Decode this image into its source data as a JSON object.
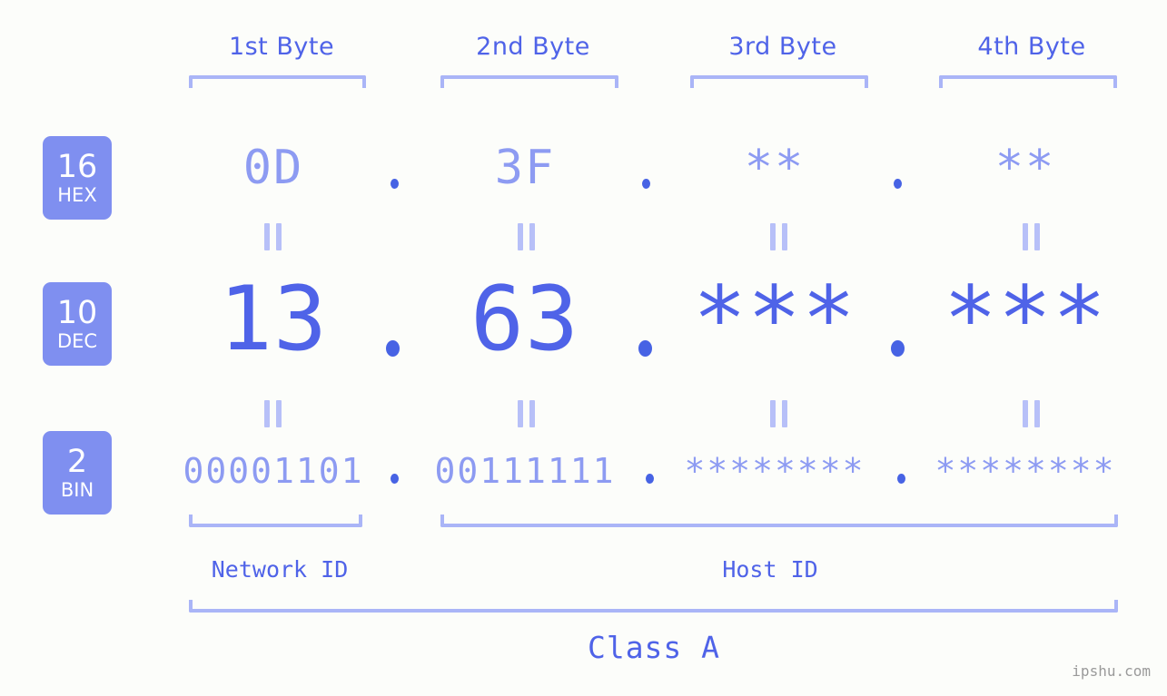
{
  "page": {
    "background_color": "#fcfdfa",
    "accent_color": "#4f63e8",
    "accent_light_color": "#8d9bf2",
    "bracket_color": "#aab5f7",
    "badge_color": "#7f8ff0",
    "watermark": "ipshu.com"
  },
  "columns": [
    {
      "title": "1st Byte"
    },
    {
      "title": "2nd Byte"
    },
    {
      "title": "3rd Byte"
    },
    {
      "title": "4th Byte"
    }
  ],
  "rows": {
    "hex": {
      "badge_number": "16",
      "badge_base": "HEX",
      "values": [
        "0D",
        "3F",
        "**",
        "**"
      ],
      "separator": "."
    },
    "dec": {
      "badge_number": "10",
      "badge_base": "DEC",
      "values": [
        "13",
        "63",
        "***",
        "***"
      ],
      "separator": "."
    },
    "bin": {
      "badge_number": "2",
      "badge_base": "BIN",
      "values": [
        "00001101",
        "00111111",
        "********",
        "********"
      ],
      "separator": "."
    }
  },
  "equals_marks": {
    "glyph": "||",
    "count_per_row": 4
  },
  "sections": {
    "network_id": "Network ID",
    "host_id": "Host ID",
    "class": "Class A"
  }
}
